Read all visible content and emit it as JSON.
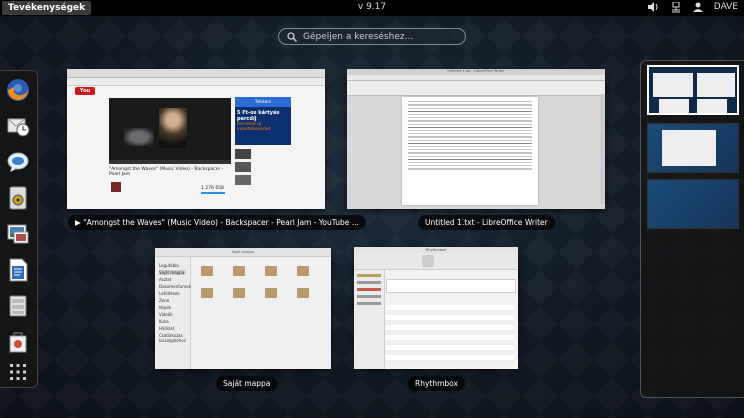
{
  "topbar": {
    "activities_label": "Tevékenységek",
    "clock": "v  9.17",
    "user_name": "DAVE"
  },
  "search": {
    "placeholder": "Gépeljen a kereséshez…"
  },
  "dash": {
    "items": [
      {
        "name": "firefox-icon"
      },
      {
        "name": "evolution-icon"
      },
      {
        "name": "empathy-icon"
      },
      {
        "name": "rhythmbox-icon"
      },
      {
        "name": "shotwell-icon"
      },
      {
        "name": "writer-icon"
      },
      {
        "name": "files-icon"
      },
      {
        "name": "software-icon"
      },
      {
        "name": "show-apps-icon"
      }
    ]
  },
  "windows": {
    "youtube": {
      "caption": "▶ \"Amongst the Waves\" (Music Video) - Backspacer - Pearl Jam - YouTube ...",
      "video_title": "\"Amongst the Waves\" (Music Video) - Backspacer - Pearl Jam",
      "ad_text": "5 Ft-os kártyás percdíj",
      "ad_sub": "Rendeld új vezetékesedet",
      "views": "1 276 658"
    },
    "writer": {
      "caption": "Untitled 1.txt - LibreOffice Writer",
      "title": "Untitled 1.txt - LibreOffice Writer"
    },
    "files": {
      "caption": "Saját mappa",
      "title": "Saját mappa",
      "sidebar": [
        "Legutóbbi",
        "Saját mappa",
        "Asztal",
        "Dokumentumok",
        "Letöltések",
        "Zene",
        "Képek",
        "Videók",
        "Kuka",
        "Hálózat",
        "Csatlakozás kiszolgálóhoz"
      ]
    },
    "rhythmbox": {
      "caption": "Rhythmbox",
      "title": "Rhythmbox"
    }
  },
  "colors": {
    "topbar": "#000000",
    "accent": "#1c4a7a",
    "youtube_red": "#cc181e"
  }
}
